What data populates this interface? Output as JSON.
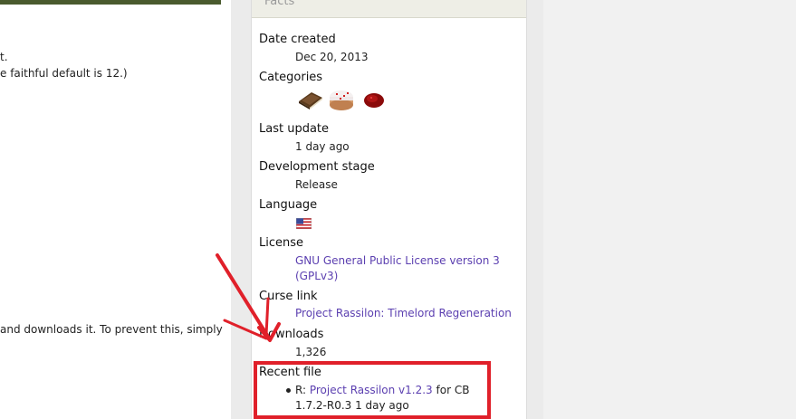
{
  "main": {
    "line1": "t.",
    "line2": "e faithful default is 12.)",
    "line3": "and downloads it. To prevent this, simply"
  },
  "facts": {
    "title": "Facts",
    "date_created_label": "Date created",
    "date_created_value": "Dec 20, 2013",
    "categories_label": "Categories",
    "categories_icons": [
      "book-icon",
      "cake-icon",
      "redstone-icon"
    ],
    "last_update_label": "Last update",
    "last_update_value": "1 day ago",
    "dev_stage_label": "Development stage",
    "dev_stage_value": "Release",
    "language_label": "Language",
    "language_icon": "us-flag-icon",
    "license_label": "License",
    "license_line1": "GNU General Public License version 3",
    "license_line2": "(GPLv3)",
    "curse_label": "Curse link",
    "curse_value": "Project Rassilon: Timelord Regeneration",
    "downloads_label": "Downloads",
    "downloads_value": "1,326",
    "recent_label": "Recent file",
    "recent_prefix": "R: ",
    "recent_link": "Project Rassilon v1.2.3",
    "recent_suffix": " for CB",
    "recent_line2": "1.7.2-R0.3 1 day ago"
  },
  "colors": {
    "link": "#5b3fb0",
    "highlight_box": "#e0202a",
    "arrow": "#e0202a"
  }
}
